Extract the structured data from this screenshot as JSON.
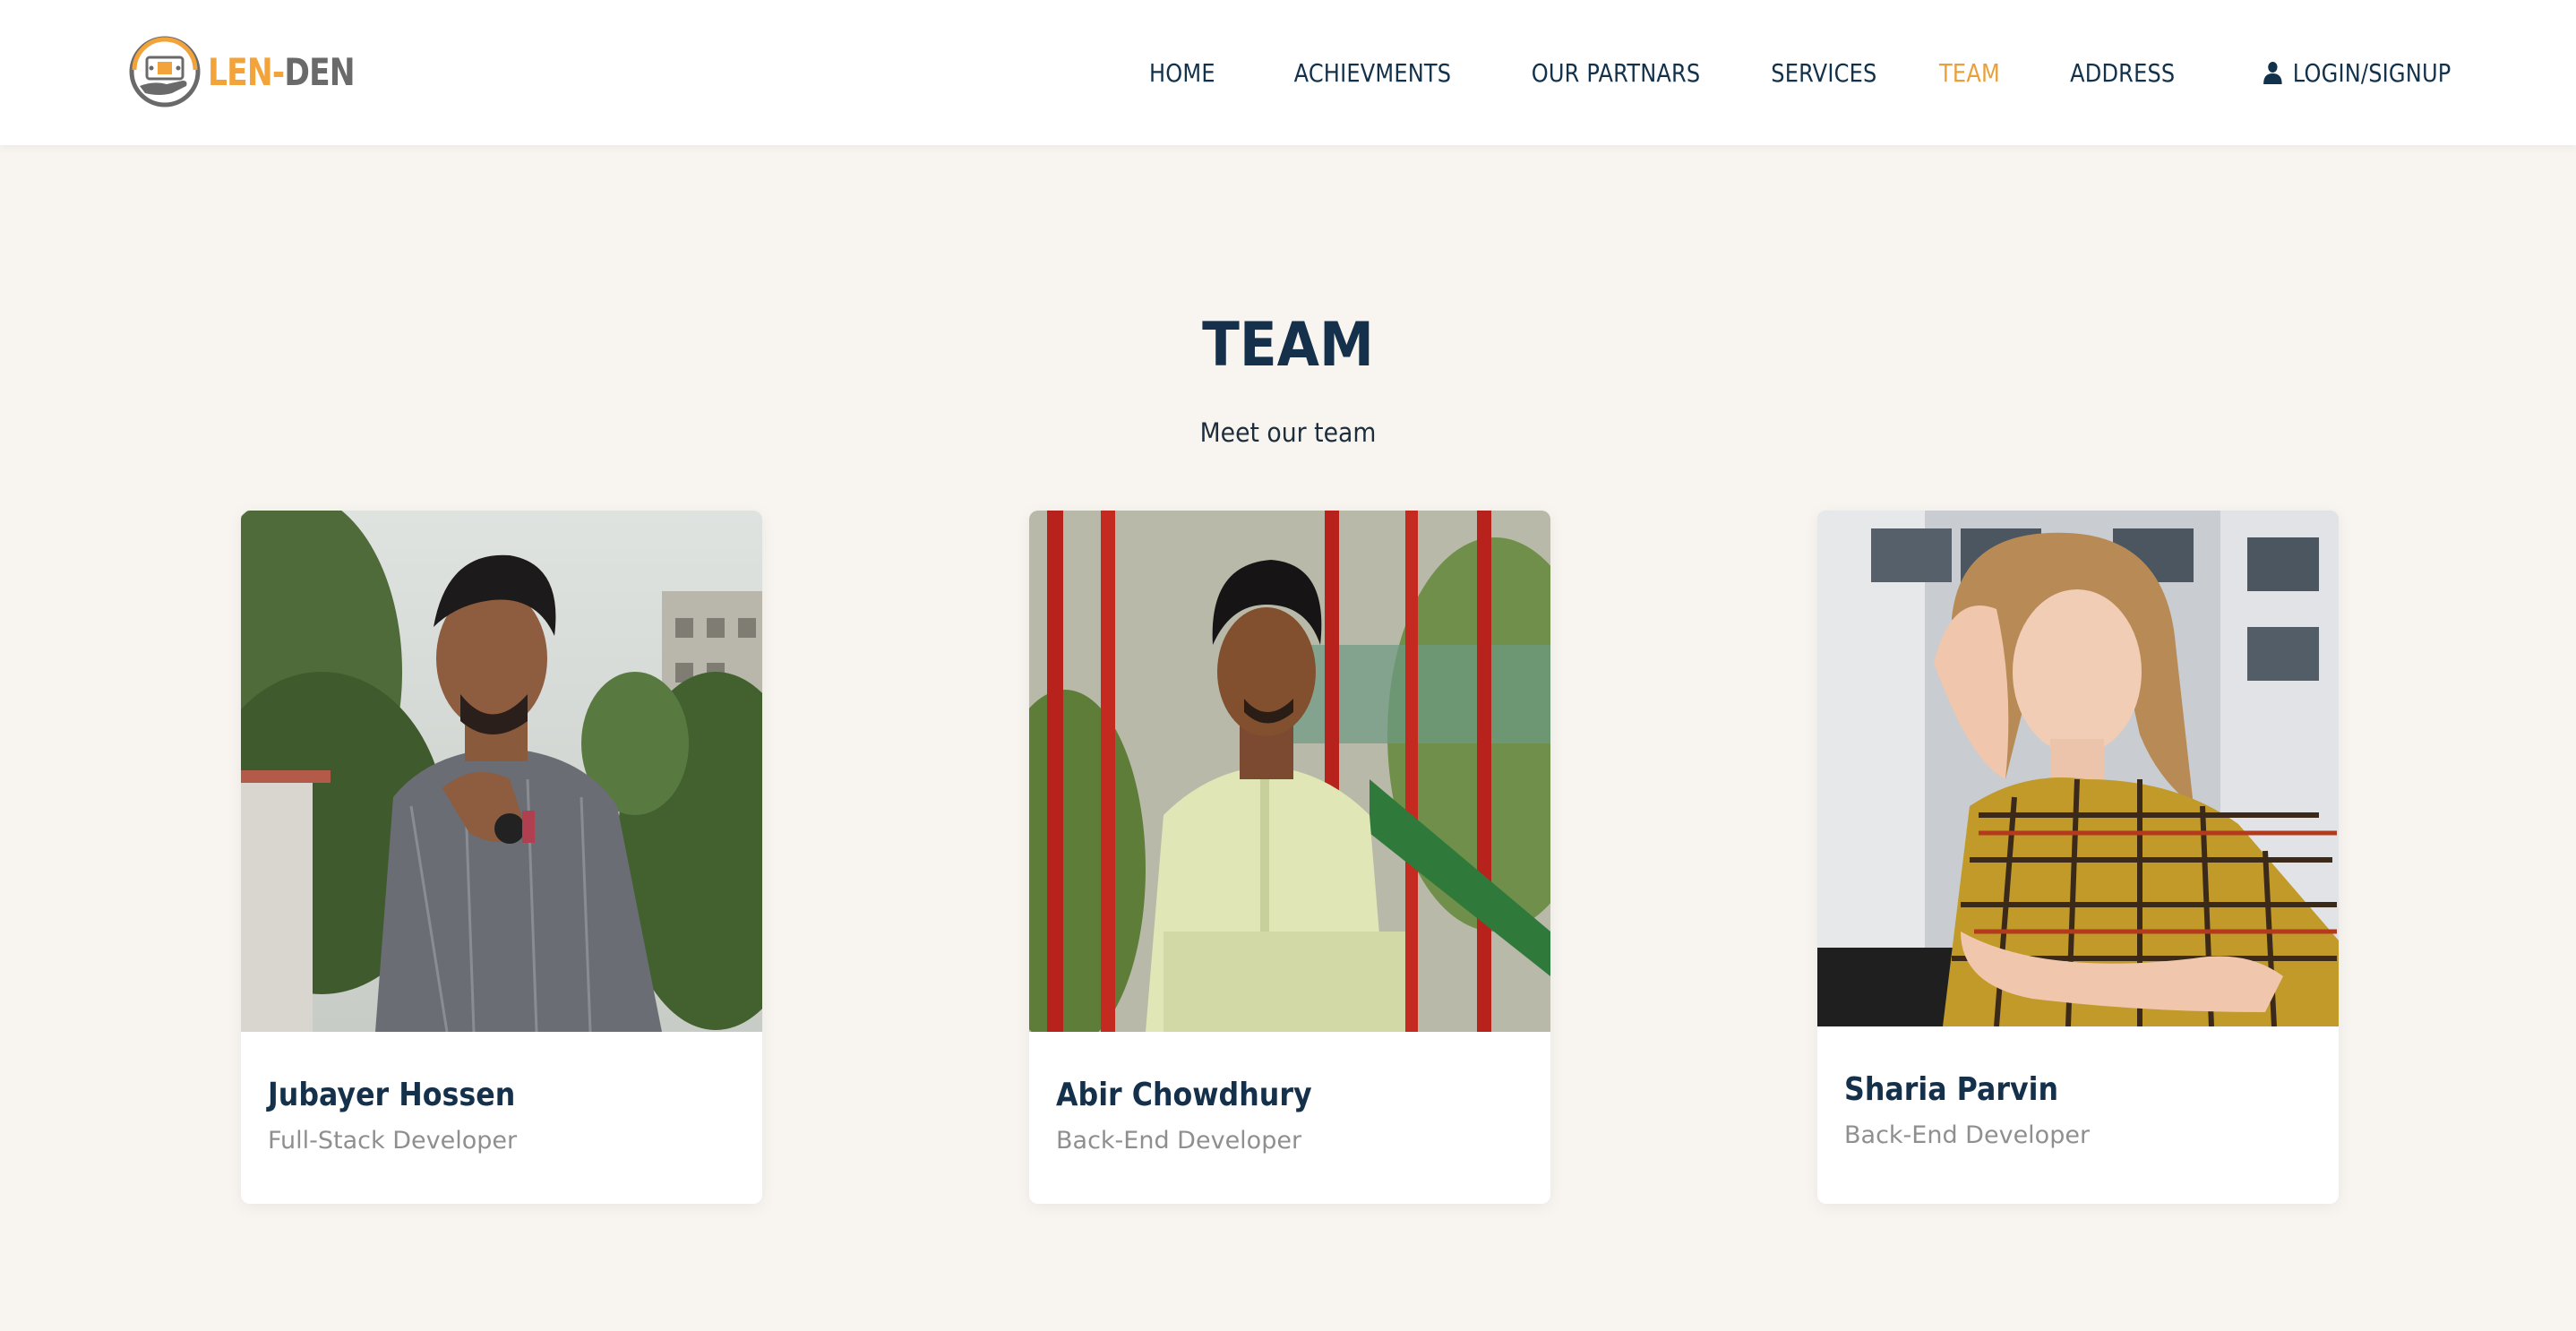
{
  "header": {
    "logo": {
      "part1": "LEN-",
      "part2": "DEN"
    },
    "nav": [
      {
        "label": "HOME",
        "active": false
      },
      {
        "label": "ACHIEVMENTS",
        "active": false
      },
      {
        "label": "OUR PARTNARS",
        "active": false
      },
      {
        "label": "SERVICES",
        "active": false
      },
      {
        "label": "TEAM",
        "active": true
      },
      {
        "label": "ADDRESS",
        "active": false
      }
    ],
    "login": {
      "label": "LOGIN/SIGNUP",
      "icon": "user-icon"
    }
  },
  "section": {
    "title": "TEAM",
    "subtitle": "Meet our team"
  },
  "team": [
    {
      "name": "Jubayer Hossen",
      "role": "Full-Stack Developer"
    },
    {
      "name": "Abir Chowdhury",
      "role": "Back-End Developer"
    },
    {
      "name": "Sharia Parvin",
      "role": "Back-End Developer"
    }
  ],
  "colors": {
    "accent": "#e9a03b",
    "navy": "#14304a",
    "background": "#f8f5f0",
    "muted": "#8f8f8f"
  }
}
